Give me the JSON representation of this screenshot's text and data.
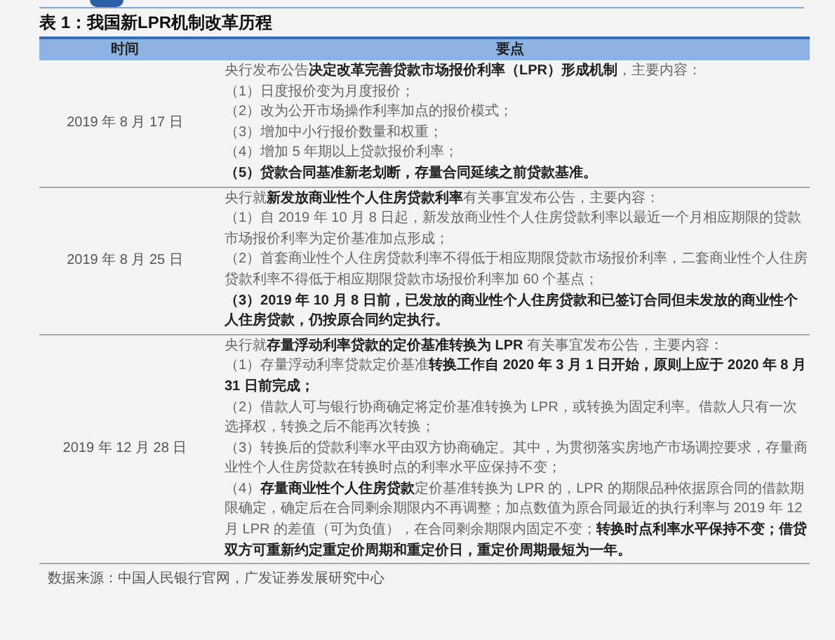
{
  "table": {
    "caption": "表 1：我国新LPR机制改革历程",
    "columns": [
      "时间",
      "要点"
    ],
    "rows": [
      {
        "date": "2019 年 8 月 17 日",
        "points": [
          {
            "text": "央行发布公告**决定改革完善贷款市场报价利率（LPR）形成机制**，主要内容：",
            "bold": false
          },
          {
            "text": "（1）日度报价变为月度报价；",
            "bold": false
          },
          {
            "text": "（2）改为公开市场操作利率加点的报价模式；",
            "bold": false
          },
          {
            "text": "（3）增加中小行报价数量和权重；",
            "bold": false
          },
          {
            "text": "（4）增加 5 年期以上贷款报价利率；",
            "bold": false
          },
          {
            "text": "（5）贷款合同基准新老划断，存量合同延续之前贷款基准。",
            "bold": true
          }
        ]
      },
      {
        "date": "2019 年 8 月 25 日",
        "points": [
          {
            "text": "央行就**新发放商业性个人住房贷款利率**有关事宜发布公告，主要内容：",
            "bold": false
          },
          {
            "text": "（1）自 2019 年 10 月 8 日起，新发放商业性个人住房贷款利率以最近一个月相应期限的贷款市场报价利率为定价基准加点形成；",
            "bold": false
          },
          {
            "text": "（2）首套商业性个人住房贷款利率不得低于相应期限贷款市场报价利率，二套商业性个人住房贷款利率不得低于相应期限贷款市场报价利率加 60 个基点；",
            "bold": false
          },
          {
            "text": "（3）2019 年 10 月 8 日前，已发放的商业性个人住房贷款和已签订合同但未发放的商业性个人住房贷款，仍按原合同约定执行。",
            "bold": true
          }
        ]
      },
      {
        "date": "2019 年 12 月 28 日",
        "points": [
          {
            "text": "央行就**存量浮动利率贷款的定价基准转换为 LPR** 有关事宜发布公告，主要内容：",
            "bold": false
          },
          {
            "text": "（1）存量浮动利率贷款定价基准**转换工作自 2020 年 3 月 1 日开始，原则上应于 2020 年 8 月 31 日前完成；**",
            "bold": false
          },
          {
            "text": "（2）借款人可与银行协商确定将定价基准转换为 LPR，或转换为固定利率。借款人只有一次选择权，转换之后不能再次转换；",
            "bold": false
          },
          {
            "text": "（3）转换后的贷款利率水平由双方协商确定。其中，为贯彻落实房地产市场调控要求，存量商业性个人住房贷款在转换时点的利率水平应保持不变；",
            "bold": false
          },
          {
            "text": "（4）**存量商业性个人住房贷款**定价基准转换为 LPR 的，LPR 的期限品种依据原合同的借款期限确定，确定后在合同剩余期限内不再调整；加点数值为原合同最近的执行利率与 2019 年 12 月 LPR 的差值（可为负值），在合同剩余期限内固定不变；**转换时点利率水平保持不变；借贷双方可重新约定重定价周期和重定价日，重定价周期最短为一年。**",
            "bold": false
          }
        ]
      }
    ],
    "source": "数据来源：中国人民银行官网，广发证券发展研究中心"
  }
}
